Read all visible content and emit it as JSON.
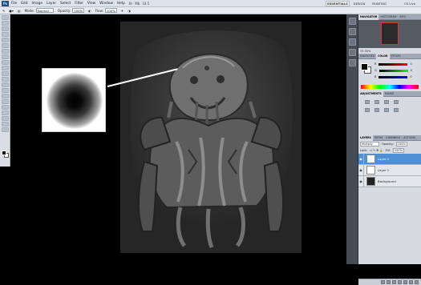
{
  "menubar": {
    "app_icon": "Ps",
    "items": [
      "File",
      "Edit",
      "Image",
      "Layer",
      "Select",
      "Filter",
      "View",
      "Window",
      "Help"
    ],
    "zoom": "33.5",
    "workspaces": [
      "ESSENTIALS",
      "DESIGN",
      "PAINTING"
    ],
    "live": "CS Live"
  },
  "options": {
    "mode_label": "Mode:",
    "mode_value": "Normal",
    "opacity_label": "Opacity:",
    "opacity_value": "100%",
    "flow_label": "Flow:",
    "flow_value": "100%"
  },
  "panels": {
    "nav_tabs": [
      "NAVIGATOR",
      "HISTOGRAM",
      "INFO"
    ],
    "nav_zoom": "33.33%",
    "color_tabs": [
      "SWATCHES",
      "COLOR",
      "STYLES"
    ],
    "color_rows": [
      {
        "ch": "R",
        "val": "0"
      },
      {
        "ch": "G",
        "val": "0"
      },
      {
        "ch": "B",
        "val": "0"
      }
    ],
    "adj_tabs": [
      "ADJUSTMENTS",
      "MASKS"
    ],
    "layer_tabs": [
      "LAYERS",
      "PATHS",
      "CHANNELS",
      "ACTIONS"
    ],
    "blend": "Multiply",
    "opacity_label": "Opacity:",
    "opacity_value": "100%",
    "lock_label": "Lock:",
    "fill_label": "Fill:",
    "fill_value": "100%",
    "layers": [
      {
        "name": "Layer 2",
        "selected": true
      },
      {
        "name": "Layer 1",
        "selected": false
      },
      {
        "name": "Background",
        "selected": false
      }
    ]
  },
  "accent_color": "#4d90d6"
}
